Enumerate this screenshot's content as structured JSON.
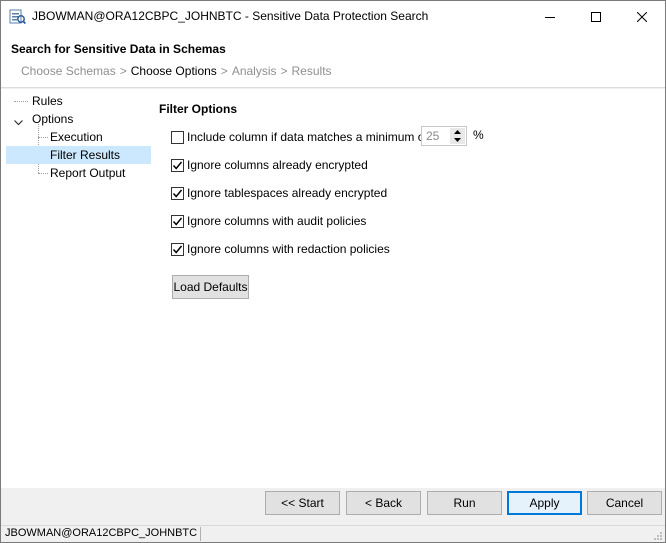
{
  "window": {
    "title": "JBOWMAN@ORA12CBPC_JOHNBTC - Sensitive Data Protection Search"
  },
  "header": {
    "title": "Search for Sensitive Data in Schemas",
    "steps": [
      "Choose Schemas",
      "Choose Options",
      "Analysis",
      "Results"
    ],
    "current_step": "Choose Options",
    "separator": ">"
  },
  "tree": {
    "items": [
      {
        "label": "Rules"
      },
      {
        "label": "Options",
        "expanded": true
      },
      {
        "label": "Execution"
      },
      {
        "label": "Filter Results",
        "selected": true
      },
      {
        "label": "Report Output"
      }
    ]
  },
  "filter": {
    "title": "Filter Options",
    "options": [
      {
        "label": "Include column if data matches a minimum of",
        "checked": false
      },
      {
        "label": "Ignore columns already encrypted",
        "checked": true
      },
      {
        "label": "Ignore tablespaces already encrypted",
        "checked": true
      },
      {
        "label": "Ignore columns with audit policies",
        "checked": true
      },
      {
        "label": "Ignore columns with redaction policies",
        "checked": true
      }
    ],
    "min_percent": "25",
    "percent_sign": "%",
    "load_defaults_label": "Load Defaults"
  },
  "buttons": {
    "start": "<< Start",
    "back": "< Back",
    "run": "Run",
    "apply": "Apply",
    "cancel": "Cancel"
  },
  "status": {
    "connection": "JBOWMAN@ORA12CBPC_JOHNBTC"
  },
  "colors": {
    "selection": "#cce8ff",
    "default_button_border": "#0078d7"
  }
}
